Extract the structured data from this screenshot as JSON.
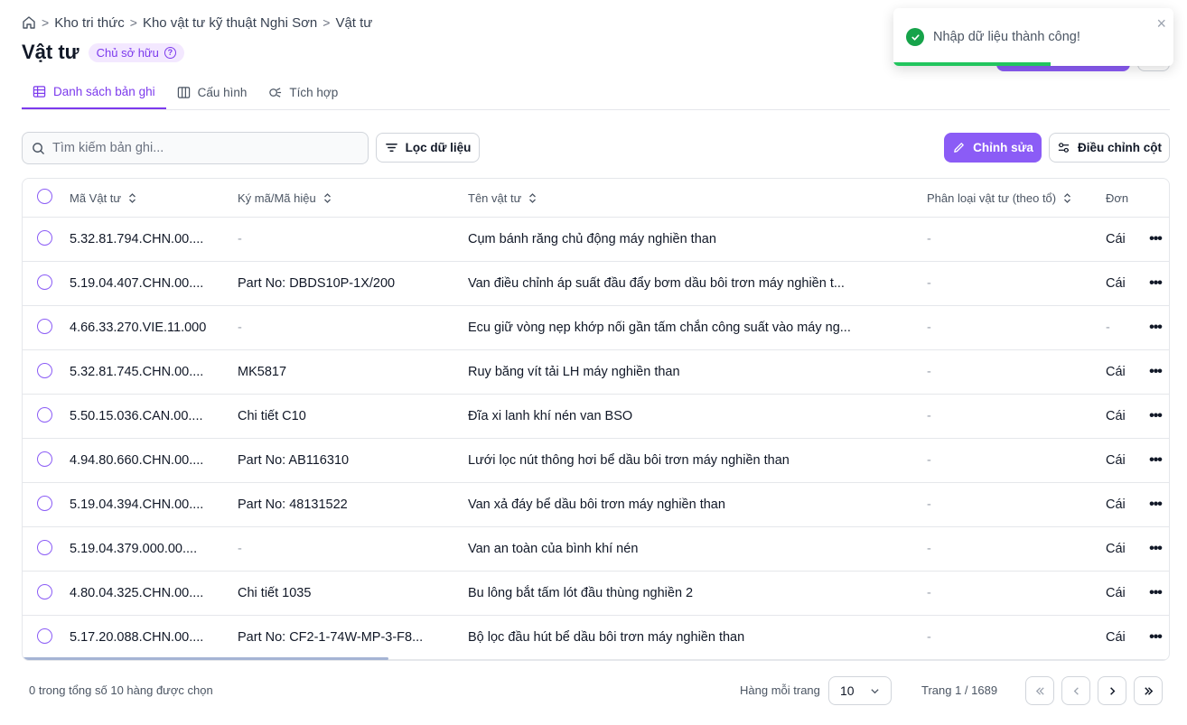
{
  "breadcrumb": {
    "items": [
      "Kho tri thức",
      "Kho vật tư kỹ thuật Nghi Sơn",
      "Vật tư"
    ],
    "separator": ">"
  },
  "page": {
    "title": "Vật tư",
    "badge": "Chủ sở hữu"
  },
  "tabs": [
    {
      "label": "Danh sách bản ghi",
      "icon": "table-icon",
      "active": true
    },
    {
      "label": "Cấu hình",
      "icon": "columns-icon",
      "active": false
    },
    {
      "label": "Tích hợp",
      "icon": "integration-icon",
      "active": false
    }
  ],
  "toolbar": {
    "search_placeholder": "Tìm kiếm bản ghi...",
    "filter_label": "Lọc dữ liệu",
    "edit_label": "Chỉnh sửa",
    "adjust_columns_label": "Điều chỉnh cột"
  },
  "table": {
    "headers": [
      "Mã Vật tư",
      "Ký mã/Mã hiệu",
      "Tên vật tư",
      "Phân loại vật tư (theo tổ)",
      "Đơn"
    ],
    "rows": [
      {
        "ma": "5.32.81.794.CHN.00....",
        "ky": "-",
        "ten": "Cụm bánh răng chủ động máy nghiền than",
        "pl": "-",
        "don": "Cái"
      },
      {
        "ma": "5.19.04.407.CHN.00....",
        "ky": "Part No: DBDS10P-1X/200",
        "ten": "Van điều chỉnh áp suất đầu đẩy bơm dầu bôi trơn máy nghiền t...",
        "pl": "-",
        "don": "Cái"
      },
      {
        "ma": "4.66.33.270.VIE.11.000",
        "ky": "-",
        "ten": "Ecu giữ vòng nẹp khớp nối gần tấm chắn công suất vào máy ng...",
        "pl": "-",
        "don": "-"
      },
      {
        "ma": "5.32.81.745.CHN.00....",
        "ky": "MK5817",
        "ten": "Ruy băng vít tải LH máy nghiền than",
        "pl": "-",
        "don": "Cái"
      },
      {
        "ma": "5.50.15.036.CAN.00....",
        "ky": "Chi tiết C10",
        "ten": "Đĩa xi lanh khí nén van BSO",
        "pl": "-",
        "don": "Cái"
      },
      {
        "ma": "4.94.80.660.CHN.00....",
        "ky": "Part No: AB116310",
        "ten": "Lưới lọc nút thông hơi bể dầu bôi trơn máy nghiền than",
        "pl": "-",
        "don": "Cái"
      },
      {
        "ma": "5.19.04.394.CHN.00....",
        "ky": "Part No: 48131522",
        "ten": "Van xả đáy bể dầu bôi trơn máy nghiền than",
        "pl": "-",
        "don": "Cái"
      },
      {
        "ma": "5.19.04.379.000.00....",
        "ky": "-",
        "ten": "Van an toàn của bình khí nén",
        "pl": "-",
        "don": "Cái"
      },
      {
        "ma": "4.80.04.325.CHN.00....",
        "ky": "Chi tiết 1035",
        "ten": "Bu lông bắt tấm lót đầu thùng nghiền 2",
        "pl": "-",
        "don": "Cái"
      },
      {
        "ma": "5.17.20.088.CHN.00....",
        "ky": "Part No: CF2-1-74W-MP-3-F8...",
        "ten": "Bộ lọc đầu hút bể dầu bôi trơn máy nghiền than",
        "pl": "-",
        "don": "Cái"
      }
    ]
  },
  "footer": {
    "selection": "0 trong tổng số 10 hàng được chọn",
    "rows_per_page_label": "Hàng mỗi trang",
    "rows_per_page": "10",
    "page_info": "Trang 1 / 1689"
  },
  "toast": {
    "message": "Nhập dữ liệu thành công!",
    "progress": 0.56
  },
  "colors": {
    "accent": "#8b5cf6",
    "success": "#16a34a"
  }
}
